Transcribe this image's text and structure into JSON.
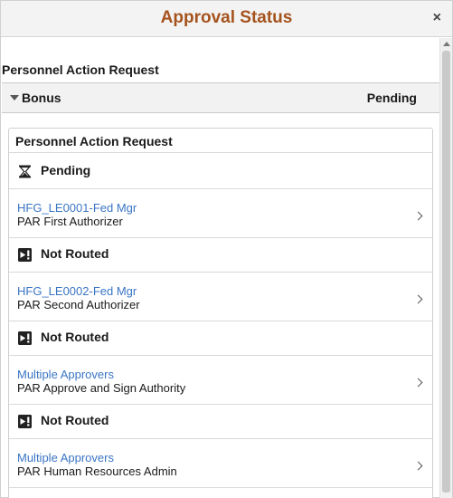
{
  "dialog": {
    "title": "Approval Status",
    "close_glyph": "×"
  },
  "section_label": "Personnel Action Request",
  "group": {
    "title": "Bonus",
    "status": "Pending"
  },
  "card": {
    "title": "Personnel Action Request",
    "steps": [
      {
        "status": "Pending",
        "status_icon": "hourglass-icon",
        "approver": "HFG_LE0001-Fed Mgr",
        "role": "PAR First Authorizer"
      },
      {
        "status": "Not Routed",
        "status_icon": "not-routed-icon",
        "approver": "HFG_LE0002-Fed Mgr",
        "role": "PAR Second Authorizer"
      },
      {
        "status": "Not Routed",
        "status_icon": "not-routed-icon",
        "approver": "Multiple Approvers",
        "role": "PAR Approve and Sign Authority"
      },
      {
        "status": "Not Routed",
        "status_icon": "not-routed-icon",
        "approver": "Multiple Approvers",
        "role": "PAR Human Resources Admin"
      }
    ]
  },
  "colors": {
    "title": "#a5531d",
    "link": "#3a75c4"
  }
}
